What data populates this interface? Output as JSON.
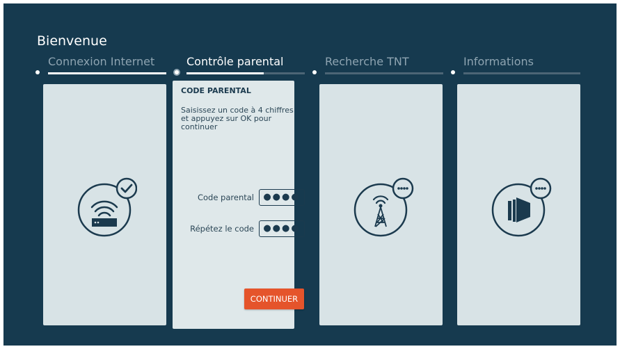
{
  "title": "Bienvenue",
  "steps": [
    {
      "label": "Connexion Internet",
      "state": "done",
      "progress": 1.0
    },
    {
      "label": "Contrôle parental",
      "state": "active",
      "progress": 0.65
    },
    {
      "label": "Recherche TNT",
      "state": "pending",
      "progress": 0
    },
    {
      "label": "Informations",
      "state": "pending",
      "progress": 0
    }
  ],
  "cards": [
    {
      "icon": "wifi-router-icon",
      "badge": "check-badge-icon"
    },
    {
      "icon": null
    },
    {
      "icon": "antenna-tower-icon",
      "badge": "more-badge-icon"
    },
    {
      "icon": "info-panels-icon",
      "badge": "more-badge-icon"
    }
  ],
  "parental": {
    "heading": "CODE PARENTAL",
    "instructions": "Saisissez un code à 4 chiffres et appuyez sur OK pour continuer",
    "code_label": "Code parental",
    "code_value": "●●●●",
    "confirm_label": "Répétez le code",
    "confirm_value": "●●●●",
    "continue_label": "CONTINUER"
  },
  "colors": {
    "background": "#163a4f",
    "card": "#d8e3e6",
    "accent": "#e5542b",
    "icon": "#1b3a4e"
  }
}
